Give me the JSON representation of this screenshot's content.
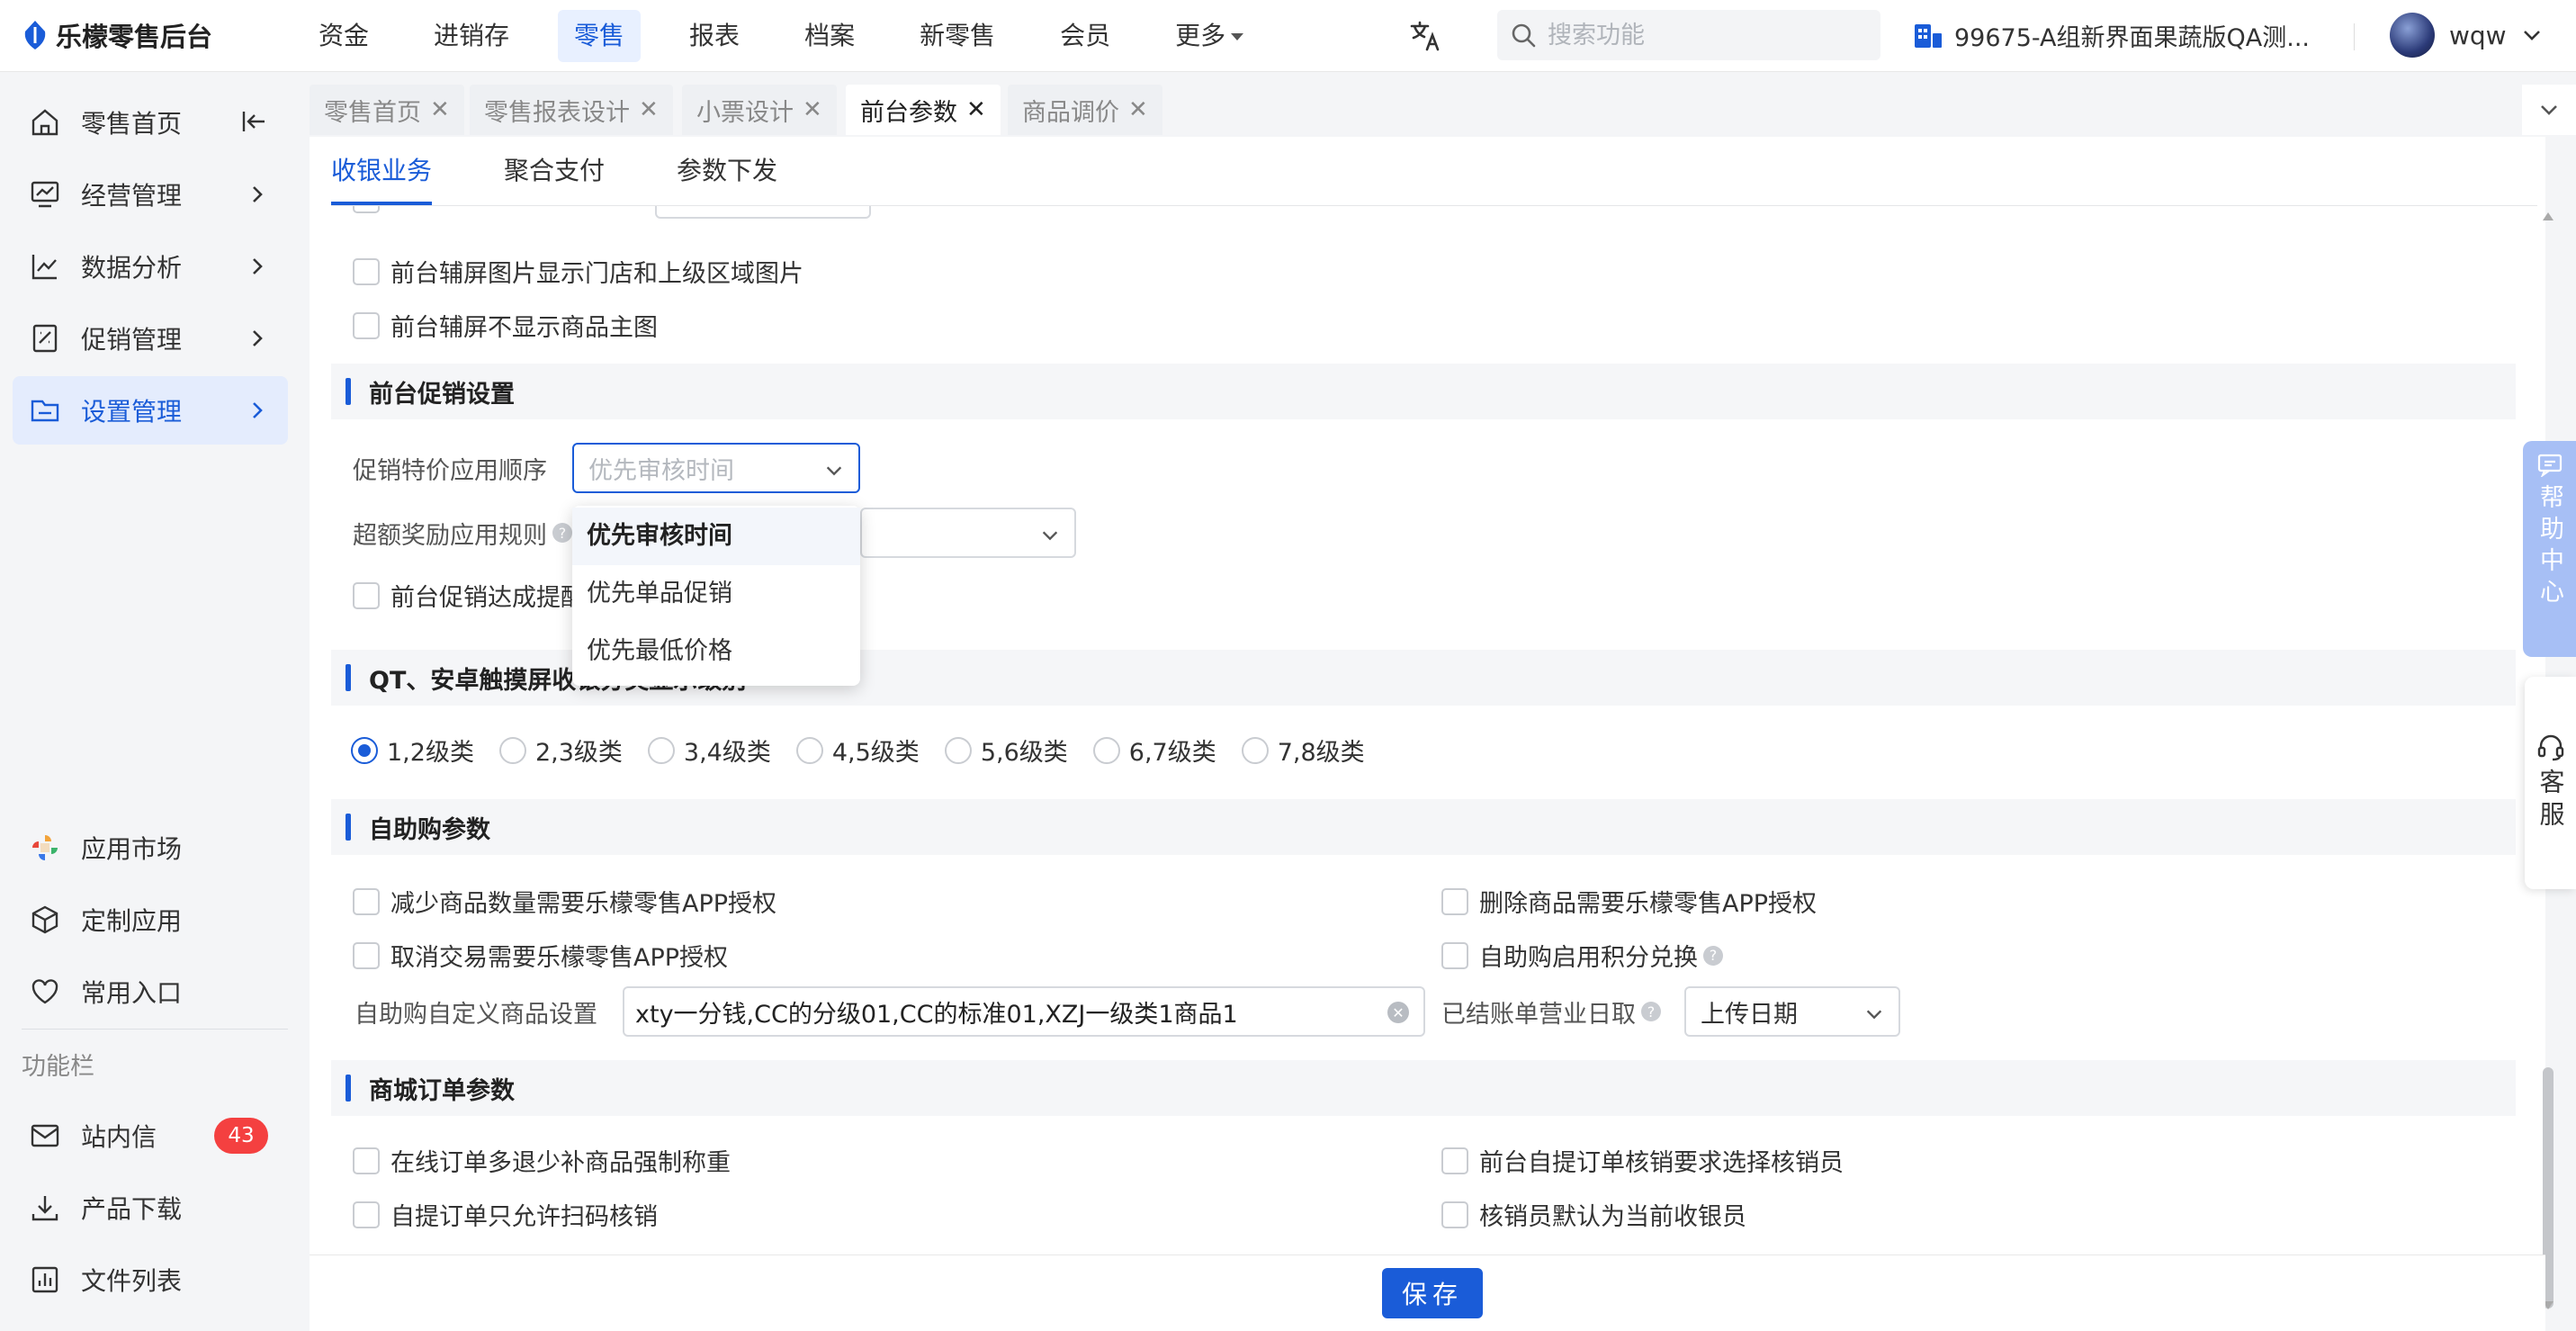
{
  "brand": {
    "name": "乐檬零售后台",
    "accent": "#1a5cd8"
  },
  "nav": {
    "items": [
      {
        "label": "资金"
      },
      {
        "label": "进销存"
      },
      {
        "label": "零售",
        "active": true
      },
      {
        "label": "报表"
      },
      {
        "label": "档案"
      },
      {
        "label": "新零售"
      },
      {
        "label": "会员"
      },
      {
        "label": "更多"
      }
    ]
  },
  "search": {
    "placeholder": "搜索功能"
  },
  "store": {
    "name": "99675-A组新界面果蔬版QA测..."
  },
  "user": {
    "name": "wqw"
  },
  "sidebar": {
    "items": [
      {
        "label": "零售首页"
      },
      {
        "label": "经营管理"
      },
      {
        "label": "数据分析"
      },
      {
        "label": "促销管理"
      },
      {
        "label": "设置管理",
        "active": true
      }
    ],
    "bottom_items": [
      {
        "label": "应用市场"
      },
      {
        "label": "定制应用"
      },
      {
        "label": "常用入口"
      }
    ],
    "section_title": "功能栏",
    "tool_items": [
      {
        "label": "站内信",
        "badge": "43"
      },
      {
        "label": "产品下载"
      },
      {
        "label": "文件列表"
      }
    ]
  },
  "page_tabs": [
    {
      "label": "零售首页"
    },
    {
      "label": "零售报表设计"
    },
    {
      "label": "小票设计"
    },
    {
      "label": "前台参数",
      "active": true
    },
    {
      "label": "商品调价"
    }
  ],
  "subtabs": [
    {
      "label": "收银业务",
      "active": true
    },
    {
      "label": "聚合支付"
    },
    {
      "label": "参数下发"
    }
  ],
  "screen": {
    "cb1": "前台辅屏图片显示门店和上级区域图片",
    "cb2": "前台辅屏不显示商品主图"
  },
  "promo": {
    "title": "前台促销设置",
    "order_label": "促销特价应用顺序",
    "order_placeholder": "优先审核时间",
    "bonus_label": "超额奖励应用规则",
    "cb_reach": "前台促销达成提醒",
    "options": [
      "优先审核时间",
      "优先单品促销",
      "优先最低价格"
    ]
  },
  "qt": {
    "title": "QT、安卓触摸屏收银分类显示级别",
    "levels": [
      "1,2级类",
      "2,3级类",
      "3,4级类",
      "4,5级类",
      "5,6级类",
      "6,7级类",
      "7,8级类"
    ]
  },
  "self": {
    "title": "自助购参数",
    "cb_reduce": "减少商品数量需要乐檬零售APP授权",
    "cb_delete": "删除商品需要乐檬零售APP授权",
    "cb_cancel": "取消交易需要乐檬零售APP授权",
    "cb_points": "自助购启用积分兑换",
    "custom_label": "自助购自定义商品设置",
    "custom_value": "xty一分钱,CC的分级01,CC的标准01,XZJ一级类1商品1",
    "bizday_label": "已结账单营业日取",
    "bizday_value": "上传日期"
  },
  "mall": {
    "title": "商城订单参数",
    "cb_weigh": "在线订单多退少补商品强制称重",
    "cb_pickup_staff": "前台自提订单核销要求选择核销员",
    "cb_scan_only": "自提订单只允许扫码核销",
    "cb_default_cashier": "核销员默认为当前收银员"
  },
  "save_label": "保存",
  "float": {
    "help_center": "帮助中心",
    "service": "客服"
  }
}
